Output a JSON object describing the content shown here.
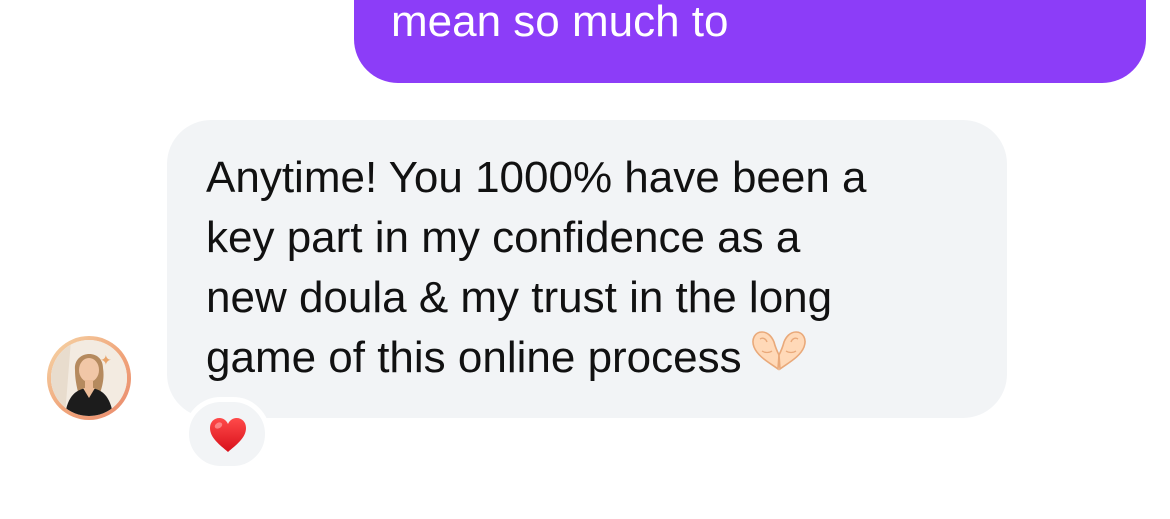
{
  "thread": {
    "outgoing_message": {
      "text": "mean so much to",
      "color": "#8c3df8"
    },
    "incoming_message": {
      "lines": [
        "Anytime! You 1000% have been a",
        "key part in my confidence as a",
        "new doula & my trust in the long",
        "game of this online process"
      ],
      "emoji": "heart-hands-emoji",
      "bubble_color": "#f2f4f6"
    },
    "sender_avatar": {
      "icon": "sender-avatar"
    },
    "reaction": {
      "icon": "red-heart-emoji"
    }
  }
}
